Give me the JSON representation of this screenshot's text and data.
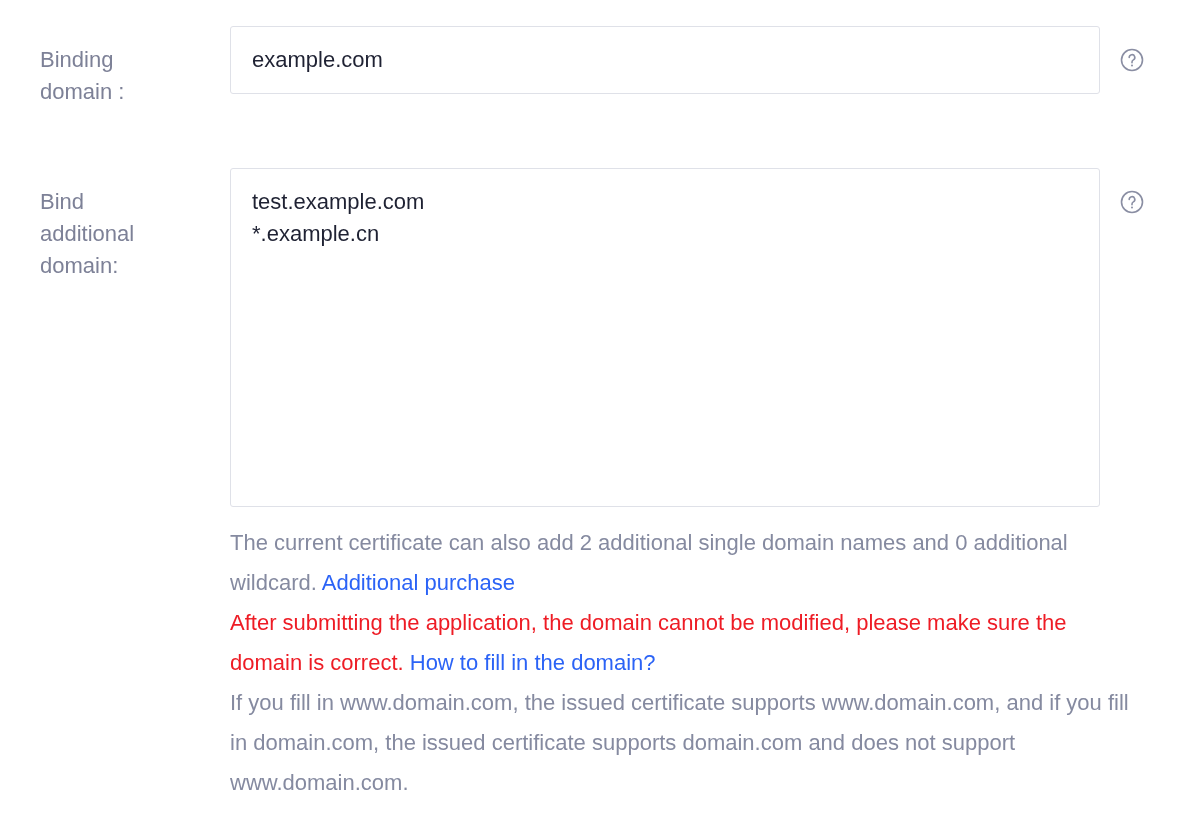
{
  "fields": [
    {
      "kind": "input",
      "label": "Binding domain :",
      "value": "example.com"
    },
    {
      "kind": "textarea",
      "label": "Bind additional domain:",
      "lines": [
        "test.example.com",
        "*.example.cn"
      ]
    }
  ],
  "notes": [
    {
      "kind": "info",
      "text": "The current certificate can also add 2 additional single domain names and 0 additional wildcard.",
      "link": "Additional purchase"
    },
    {
      "kind": "warning",
      "text": "After submitting the application, the domain cannot be modified, please make sure the domain is correct.",
      "link": "How to fill in the domain?"
    },
    {
      "kind": "info",
      "text": "If you fill in www.domain.com, the issued certificate supports www.domain.com, and if you fill in domain.com, the issued certificate supports domain.com and does not support www.domain.com."
    }
  ]
}
